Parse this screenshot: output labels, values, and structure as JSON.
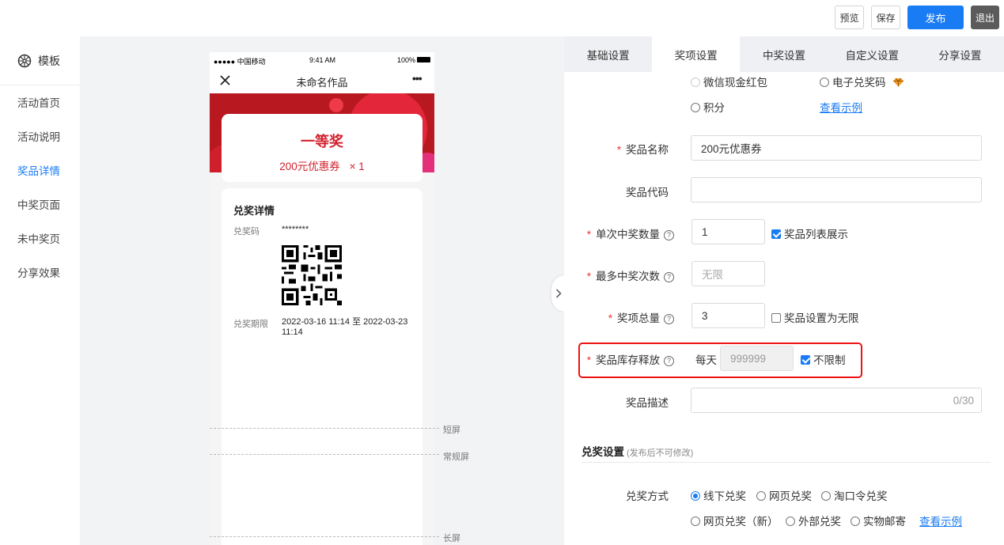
{
  "topbar": {
    "preview_label": "预览",
    "save_label": "保存",
    "publish_label": "发布",
    "exit_label": "退出"
  },
  "sidebar": {
    "template_label": "模板",
    "items": [
      {
        "label": "活动首页"
      },
      {
        "label": "活动说明"
      },
      {
        "label": "奖品详情"
      },
      {
        "label": "中奖页面"
      },
      {
        "label": "未中奖页"
      },
      {
        "label": "分享效果"
      }
    ]
  },
  "phone": {
    "carrier": "●●●●● 中国移动",
    "time": "9:41 AM",
    "battery": "100%",
    "page_title": "未命名作品",
    "more": "•••",
    "prize_level": "一等奖",
    "prize_name": "200元优惠券",
    "prize_qty": "× 1",
    "detail_title": "兑奖详情",
    "code_label": "兑奖码",
    "code_value": "********",
    "period_label": "兑奖期限",
    "period_value": "2022-03-16 11:14 至 2022-03-23 11:14"
  },
  "guides": {
    "short": "短屏",
    "normal": "常规屏",
    "long": "长屏"
  },
  "tabs": [
    {
      "label": "基础设置"
    },
    {
      "label": "奖项设置"
    },
    {
      "label": "中奖设置"
    },
    {
      "label": "自定义设置"
    },
    {
      "label": "分享设置"
    }
  ],
  "form": {
    "prize_types": {
      "wechat_redpacket": "微信现金红包",
      "ecode": "电子兑奖码",
      "points": "积分",
      "view_example": "查看示例"
    },
    "prize_name_label": "奖品名称",
    "prize_name_value": "200元优惠券",
    "prize_code_label": "奖品代码",
    "single_win_label": "单次中奖数量",
    "single_win_value": "1",
    "list_display_label": "奖品列表展示",
    "max_win_label": "最多中奖次数",
    "max_win_placeholder": "无限",
    "total_label": "奖项总量",
    "total_value": "3",
    "unlimited_total_label": "奖品设置为无限",
    "stock_release_label": "奖品库存释放",
    "per_day_label": "每天",
    "per_day_value": "999999",
    "no_limit_label": "不限制",
    "desc_label": "奖品描述",
    "desc_counter": "0/30"
  },
  "redeem": {
    "section_title": "兑奖设置",
    "section_note": "(发布后不可修改)",
    "method_label": "兑奖方式",
    "options": {
      "offline": "线下兑奖",
      "web": "网页兑奖",
      "taokouling": "淘口令兑奖",
      "web_new": "网页兑奖（新）",
      "external": "外部兑奖",
      "mail": "实物邮寄"
    },
    "view_example": "查看示例"
  },
  "colors": {
    "accent": "#1a7cf5",
    "prize_red": "#d21f2c",
    "highlight_border": "#e11111"
  }
}
